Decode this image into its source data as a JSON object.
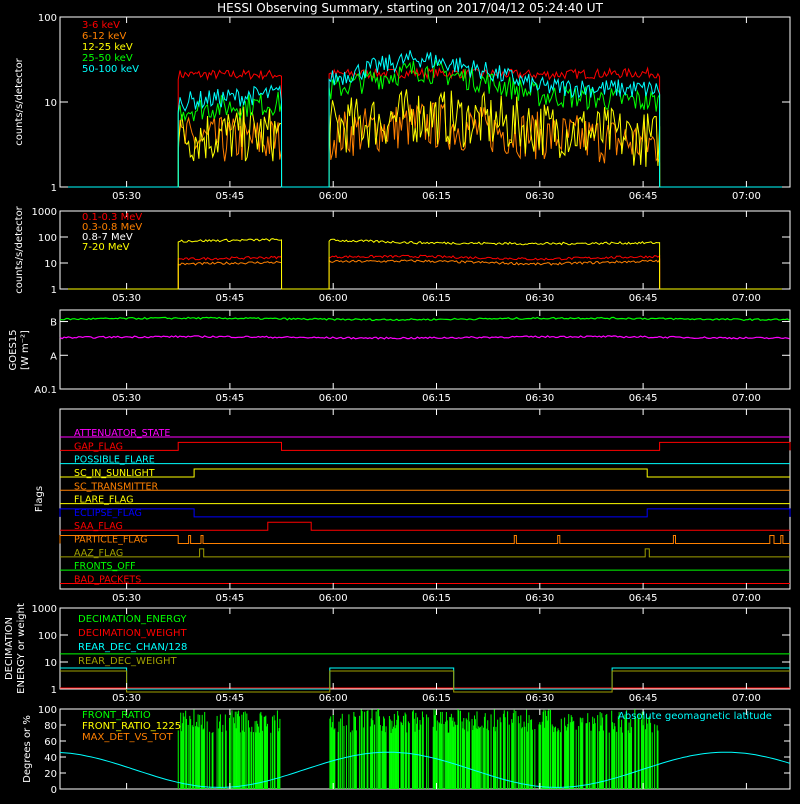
{
  "title": "HESSI Observing Summary, starting on 2017/04/12 05:24:40 UT",
  "time_axis": {
    "range_minutes": [
      -4.67,
      101.33
    ],
    "ticks": [
      {
        "t": 5,
        "label": "05:30"
      },
      {
        "t": 20,
        "label": "05:45"
      },
      {
        "t": 35,
        "label": "06:00"
      },
      {
        "t": 50,
        "label": "06:15"
      },
      {
        "t": 65,
        "label": "06:30"
      },
      {
        "t": 80,
        "label": "06:45"
      },
      {
        "t": 95,
        "label": "07:00"
      }
    ]
  },
  "colors": {
    "red": "#ff0000",
    "orange": "#ff8000",
    "yellow": "#ffff00",
    "green": "#00ff00",
    "cyan": "#00ffff",
    "magenta": "#ff00ff",
    "blue": "#0000ff",
    "olive": "#a0a000",
    "white": "#ffffff"
  },
  "chart_data": [
    {
      "id": "hxr",
      "type": "line",
      "ylabel": "counts/s/detector",
      "yscale": "log",
      "ylim": [
        1,
        100
      ],
      "ytick_labels": [
        "1",
        "10",
        "100"
      ],
      "intervals": [
        [
          12.5,
          27.5
        ],
        [
          34.4,
          82.4
        ]
      ],
      "series": [
        {
          "name": "3-6 keV",
          "color": "#ff0000",
          "level": [
            21,
            21,
            22,
            21,
            22
          ],
          "noise": 0.06
        },
        {
          "name": "6-12 keV",
          "color": "#ff8000",
          "level": [
            3.5,
            3.5,
            5.5,
            4,
            3.2
          ],
          "noise": 0.3
        },
        {
          "name": "12-25 keV",
          "color": "#ffff00",
          "level": [
            4,
            4.2,
            7,
            5,
            3.5
          ],
          "noise": 0.35
        },
        {
          "name": "25-50 keV",
          "color": "#00ff00",
          "level": [
            8,
            10,
            24,
            12,
            10
          ],
          "noise": 0.15
        },
        {
          "name": "50-100 keV",
          "color": "#00ffff",
          "level": [
            10,
            13,
            33,
            15,
            14
          ],
          "noise": 0.12
        }
      ]
    },
    {
      "id": "gamma",
      "type": "line",
      "ylabel": "counts/s/detector",
      "yscale": "log",
      "ylim": [
        1,
        1000
      ],
      "ytick_labels": [
        "1",
        "10",
        "100",
        "1000"
      ],
      "intervals": [
        [
          12.5,
          27.5
        ],
        [
          34.4,
          82.4
        ]
      ],
      "series": [
        {
          "name": "0.1-0.3 MeV",
          "color": "#ff0000",
          "level": [
            14,
            17,
            18,
            14,
            18
          ],
          "noise": 0.05
        },
        {
          "name": "0.3-0.8 MeV",
          "color": "#ff8000",
          "level": [
            9,
            11,
            12,
            9,
            12
          ],
          "noise": 0.05
        },
        {
          "name": "0.8-7 MeV",
          "color": "#ffffff",
          "level": [
            1,
            1,
            1,
            1,
            1
          ],
          "noise": 0.0
        },
        {
          "name": "7-20 MeV",
          "color": "#ffff00",
          "level": [
            70,
            80,
            60,
            55,
            60
          ],
          "noise": 0.05
        }
      ]
    },
    {
      "id": "goes",
      "type": "line",
      "ylabel": "GOES15",
      "yunit": "[W m⁻²]",
      "ytick_labels": [
        "B",
        "A",
        "A0.1"
      ],
      "series": [
        {
          "name": "",
          "color": "#00ff00",
          "level": 1.2e-07
        },
        {
          "name": "",
          "color": "#ff00ff",
          "level": 3.4e-08
        }
      ]
    },
    {
      "id": "flags",
      "type": "step",
      "ylabel": "Flags",
      "rows": [
        {
          "name": "ATTENUATOR_STATE",
          "color": "#ff00ff",
          "high": []
        },
        {
          "name": "GAP_FLAG",
          "color": "#ff0000",
          "high": [
            [
              12.5,
              27.5
            ],
            [
              82.4,
              101.33
            ]
          ]
        },
        {
          "name": "POSSIBLE_FLARE",
          "color": "#00ffff",
          "high": []
        },
        {
          "name": "SC_IN_SUNLIGHT",
          "color": "#ffff00",
          "high": [
            [
              14.8,
              80.6
            ]
          ]
        },
        {
          "name": "SC_TRANSMITTER",
          "color": "#ff8000",
          "high": []
        },
        {
          "name": "FLARE_FLAG",
          "color": "#ffff00",
          "high": []
        },
        {
          "name": "ECLIPSE_FLAG",
          "color": "#0000ff",
          "high": [
            [
              -4.67,
              14.8
            ],
            [
              80.6,
              101.33
            ]
          ]
        },
        {
          "name": "SAA_FLAG",
          "color": "#ff0000",
          "high": [
            [
              25.5,
              31.8
            ]
          ]
        },
        {
          "name": "PARTICLE_FLAG",
          "color": "#ff8000",
          "high": [
            [
              -4.67,
              12.5
            ],
            [
              14,
              14.3
            ],
            [
              15.8,
              16.1
            ],
            [
              61.3,
              61.6
            ],
            [
              67.6,
              67.9
            ],
            [
              84.4,
              84.7
            ],
            [
              98.4,
              99
            ],
            [
              100,
              100.3
            ]
          ]
        },
        {
          "name": "AAZ_FLAG",
          "color": "#a0a000",
          "high": [
            [
              15.6,
              16.2
            ],
            [
              80.3,
              80.9
            ]
          ]
        },
        {
          "name": "FRONTS_OFF",
          "color": "#00ff00",
          "high": []
        },
        {
          "name": "BAD_PACKETS",
          "color": "#ff0000",
          "high": []
        }
      ]
    },
    {
      "id": "decimation",
      "type": "step",
      "ylabel": "DECIMATION ENERGY or weight",
      "yscale": "log",
      "ylim": [
        1,
        1000
      ],
      "ytick_labels": [
        "1",
        "10",
        "100",
        "1000"
      ],
      "series": [
        {
          "name": "DECIMATION_ENERGY",
          "color": "#00ff00",
          "value": 20
        },
        {
          "name": "DECIMATION_WEIGHT",
          "color": "#ff0000",
          "value": 1
        },
        {
          "name": "REAR_DEC_CHAN/128",
          "color": "#00ffff",
          "steps": [
            [
              -4.67,
              5,
              6
            ],
            [
              5,
              34.5,
              1
            ],
            [
              34.5,
              52.5,
              6
            ],
            [
              52.5,
              75.5,
              1
            ],
            [
              75.5,
              101.33,
              6
            ]
          ]
        },
        {
          "name": "REAR_DEC_WEIGHT",
          "color": "#a0a000",
          "steps": [
            [
              -4.67,
              5,
              6
            ],
            [
              5,
              34.5,
              1
            ],
            [
              34.5,
              52.5,
              6
            ],
            [
              52.5,
              75.5,
              1
            ],
            [
              75.5,
              101.33,
              6
            ]
          ]
        }
      ]
    },
    {
      "id": "ratio",
      "type": "bar",
      "ylabel": "Degrees or %",
      "ylim": [
        0,
        100
      ],
      "ytick_labels": [
        "0",
        "20",
        "40",
        "60",
        "80",
        "100"
      ],
      "series": [
        {
          "name": "FRONT_RATIO",
          "color": "#00ff00"
        },
        {
          "name": "FRONT_RATIO_1225",
          "color": "#ffff00"
        },
        {
          "name": "MAX_DET_VS_TOT",
          "color": "#ff8000"
        },
        {
          "name": "Absolute geomagnetic latitude",
          "color": "#00ffff",
          "peaks": [
            {
              "t": 43,
              "v": 46
            },
            {
              "t": 92,
              "v": 46
            }
          ],
          "troughs": [
            {
              "t": 18,
              "v": 2
            },
            {
              "t": 67,
              "v": 2
            }
          ]
        }
      ]
    }
  ]
}
